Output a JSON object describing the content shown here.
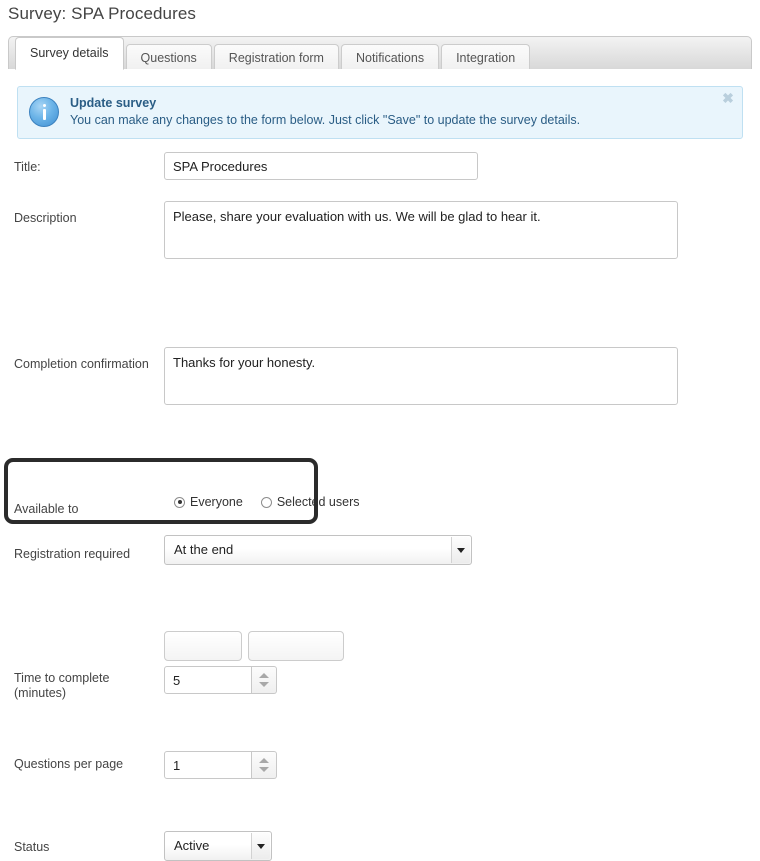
{
  "page": {
    "title": "Survey: SPA Procedures"
  },
  "tabs": [
    {
      "label": "Survey details",
      "active": true
    },
    {
      "label": "Questions",
      "active": false
    },
    {
      "label": "Registration form",
      "active": false
    },
    {
      "label": "Notifications",
      "active": false
    },
    {
      "label": "Integration",
      "active": false
    }
  ],
  "notice": {
    "icon": "info-icon",
    "title": "Update survey",
    "text": "You can make any changes to the form below. Just click \"Save\" to update the survey details.",
    "close_label": "✖",
    "background": "#e9f5fc",
    "border": "#bfe0f2",
    "text_color": "#2a5d85"
  },
  "form": {
    "title": {
      "label": "Title:",
      "value": "SPA Procedures",
      "placeholder": ""
    },
    "description": {
      "label": "Description",
      "value": "Please, share your evaluation with us. We will be glad to hear it.",
      "placeholder": ""
    },
    "completion_confirmation": {
      "label": "Completion confirmation",
      "value": "Thanks for your honesty.",
      "placeholder": ""
    },
    "available_to": {
      "label": "Available to",
      "options": [
        {
          "label": "Everyone",
          "checked": true
        },
        {
          "label": "Selected users",
          "checked": false
        }
      ]
    },
    "registration_required": {
      "label": "Registration required",
      "value": "At the end"
    },
    "time_to_complete": {
      "label_line1": "Time to complete",
      "label_line2": "(minutes)",
      "value": "5",
      "highlighted": true,
      "highlight_color": "#2b2b2b"
    },
    "questions_per_page": {
      "label": "Questions per page",
      "value": "1"
    },
    "status": {
      "label": "Status",
      "value": "Active"
    }
  },
  "footer": {
    "buttons": [
      {
        "label": ""
      },
      {
        "label": ""
      }
    ]
  }
}
